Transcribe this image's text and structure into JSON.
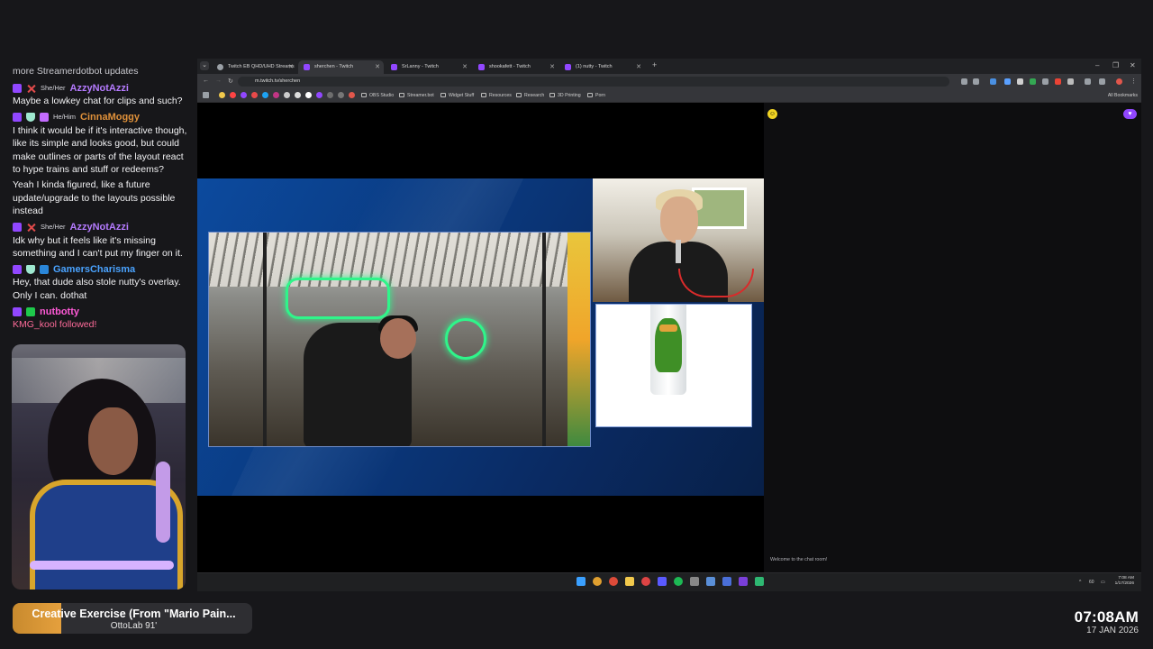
{
  "chat": {
    "header": "more Streamerdotbot updates",
    "messages": [
      {
        "pronoun": "She/Her",
        "user": "AzzyNotAzzi",
        "color": "#b57bff",
        "badges": [
          "twitch",
          "x"
        ],
        "text": "Maybe a lowkey chat for clips and such?"
      },
      {
        "pronoun": "He/Him",
        "user": "CinnaMoggy",
        "color": "#e0913a",
        "badges": [
          "twitch",
          "shield",
          "gift"
        ],
        "text": "I think it would be if it's interactive though, like its simple and looks good, but could make outlines or parts of the layout react to hype trains and stuff or redeems?"
      },
      {
        "pronoun": "",
        "user": "",
        "color": "",
        "badges": [],
        "text": "Yeah I kinda figured, like a future update/upgrade to the layouts possible instead"
      },
      {
        "pronoun": "She/Her",
        "user": "AzzyNotAzzi",
        "color": "#b57bff",
        "badges": [
          "twitch",
          "x"
        ],
        "text": "Idk why but it feels like it's missing something and I can't put my finger on it."
      },
      {
        "pronoun": "",
        "user": "GamersCharisma",
        "color": "#4aa3ff",
        "badges": [
          "twitch",
          "shield",
          "prime"
        ],
        "text": "Hey, that dude also stole nutty's overlay. Only I can. dothat"
      },
      {
        "pronoun": "",
        "user": "nutbotty",
        "color": "#ff5ad7",
        "badges": [
          "twitch",
          "green"
        ],
        "text": ""
      }
    ],
    "follow_event": "KMG_kool followed!"
  },
  "now_playing": {
    "title": "Creative Exercise (From \"Mario Pain...",
    "artist": "OttoLab 91'"
  },
  "clock": {
    "time": "07:08AM",
    "date": "17 JAN 2026"
  },
  "browser": {
    "tabs": [
      {
        "label": "Twitch EB QHD/UHD Streams",
        "icon": "globe-icon",
        "active": false
      },
      {
        "label": "sherchen - Twitch",
        "icon": "twitch-icon",
        "active": true
      },
      {
        "label": "SrLanny - Twitch",
        "icon": "twitch-icon",
        "active": false
      },
      {
        "label": "shookafett - Twitch",
        "icon": "twitch-icon",
        "active": false
      },
      {
        "label": "(1) nutty - Twitch",
        "icon": "twitch-icon",
        "active": false
      }
    ],
    "url": "m.twitch.tv/sherchen",
    "bookmarks": [
      "OBS Studio",
      "Streamer.bot",
      "Widget Stuff",
      "Resources",
      "Research",
      "3D Printing",
      "Porn"
    ],
    "all_bookmarks": "All Bookmarks",
    "chat_welcome": "Welcome to the chat room!",
    "taskbar_time": "7:08 AM",
    "taskbar_date": "1/17/2026",
    "taskbar_volume": "60"
  },
  "colors": {
    "twitch_purple": "#9147ff",
    "stage_blue": "#0c4a9e",
    "follow_pink": "#ff6b9a"
  }
}
